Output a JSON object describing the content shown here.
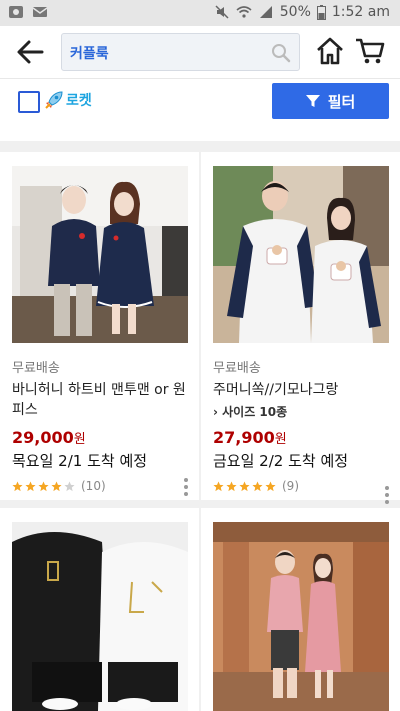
{
  "statusbar": {
    "battery": "50%",
    "time": "1:52 am"
  },
  "header": {
    "search_query": "커플룩"
  },
  "filterbar": {
    "rocket_label": "로켓",
    "filter_label": "필터"
  },
  "products": [
    {
      "shipping": "무료배송",
      "title": "바니허니 하트비 맨투맨 or 원피스",
      "sizes": "",
      "price": "29,000",
      "currency": "원",
      "arrival": "목요일 2/1 도착 예정",
      "stars": 4,
      "reviews": "(10)"
    },
    {
      "shipping": "무료배송",
      "title": "주머니쏙//기모나그랑",
      "sizes": "› 사이즈 10종",
      "price": "27,900",
      "currency": "원",
      "arrival": "금요일 2/2 도착 예정",
      "stars": 5,
      "reviews": "(9)"
    }
  ],
  "colors": {
    "accent": "#2f6ae6",
    "price": "#ae0000",
    "star": "#f5a623",
    "rocket": "#1ea5e0"
  }
}
